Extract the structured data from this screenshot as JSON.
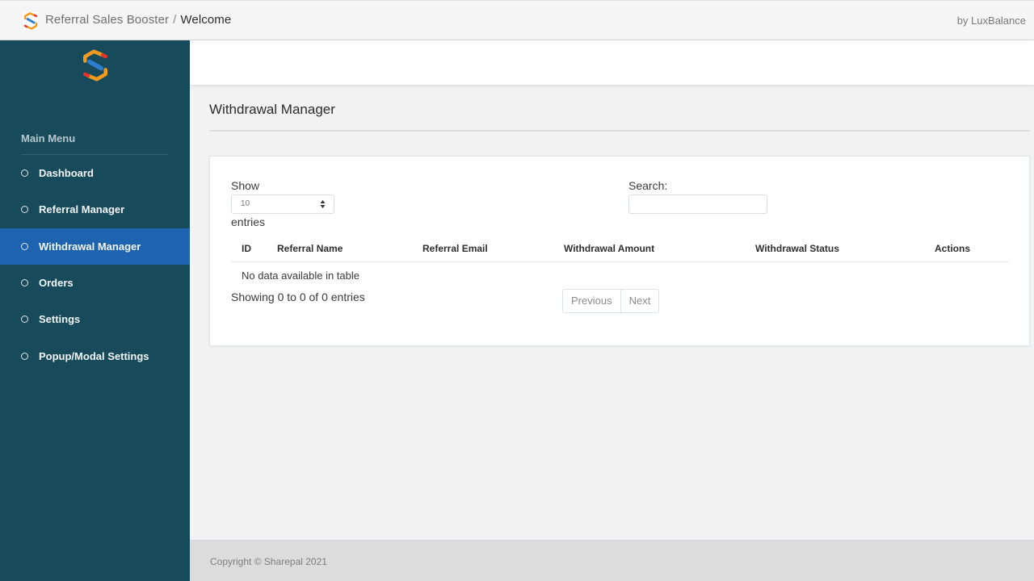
{
  "topbar": {
    "app_name": "Referral Sales Booster",
    "separator": "/",
    "current_page": "Welcome",
    "byline": "by LuxBalance",
    "logo_icon": "sharepal-s-logo"
  },
  "sidebar": {
    "logo_icon": "sharepal-s-logo",
    "menu_title": "Main Menu",
    "items": [
      {
        "label": "Dashboard",
        "active": false
      },
      {
        "label": "Referral Manager",
        "active": false
      },
      {
        "label": "Withdrawal Manager",
        "active": true
      },
      {
        "label": "Orders",
        "active": false
      },
      {
        "label": "Settings",
        "active": false
      },
      {
        "label": "Popup/Modal Settings",
        "active": false
      }
    ],
    "colors": {
      "background": "#174b5b",
      "active": "#1e63b0"
    }
  },
  "page": {
    "title": "Withdrawal Manager"
  },
  "table_controls": {
    "show_label": "Show",
    "page_length_value": "10",
    "entries_label": "entries",
    "search_label": "Search:",
    "search_value": "",
    "search_placeholder": ""
  },
  "table": {
    "columns": [
      "ID",
      "Referral Name",
      "Referral Email",
      "Withdrawal Amount",
      "Withdrawal Status",
      "Actions"
    ],
    "rows": [],
    "empty_message": "No data available in table"
  },
  "pagination": {
    "info": "Showing 0 to 0 of 0 entries",
    "previous_label": "Previous",
    "next_label": "Next"
  },
  "footer": {
    "copyright": "Copyright © Sharepal 2021"
  }
}
